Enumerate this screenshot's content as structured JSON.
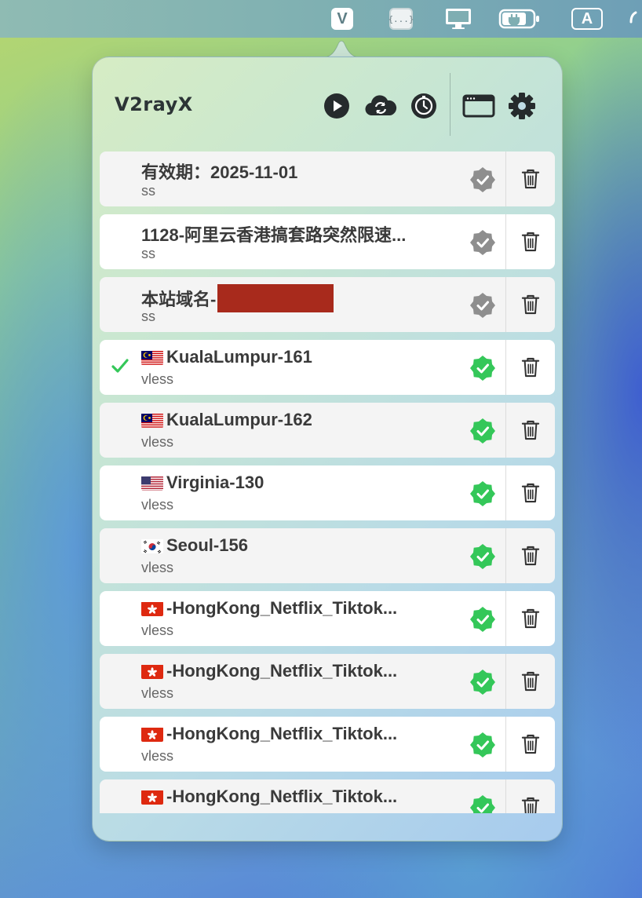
{
  "menubar": {
    "items": [
      {
        "name": "v2rayx-menubar-icon",
        "label": "V"
      },
      {
        "name": "json-menubar-icon",
        "label": "{...}"
      },
      {
        "name": "display-icon",
        "label": ""
      },
      {
        "name": "battery-icon",
        "label": ""
      },
      {
        "name": "input-source-icon",
        "label": "A"
      }
    ]
  },
  "app": {
    "title": "V2rayX"
  },
  "toolbar": {
    "icons": [
      "play-icon",
      "cloud-sync-icon",
      "timer-icon",
      "window-icon",
      "gear-icon"
    ]
  },
  "servers": [
    {
      "title": "有效期：2025-11-01",
      "protocol": "ss",
      "flag": "",
      "selected": false,
      "verified_color": "#8e8e8e",
      "redacted": false
    },
    {
      "title": "1128-阿里云香港搞套路突然限速...",
      "protocol": "ss",
      "flag": "",
      "selected": false,
      "verified_color": "#8e8e8e",
      "redacted": false
    },
    {
      "title": "本站域名-",
      "protocol": "ss",
      "flag": "",
      "selected": false,
      "verified_color": "#8e8e8e",
      "redacted": true
    },
    {
      "title": "KualaLumpur-161",
      "protocol": "vless",
      "flag": "my",
      "selected": true,
      "verified_color": "#34c759",
      "redacted": false
    },
    {
      "title": "KualaLumpur-162",
      "protocol": "vless",
      "flag": "my",
      "selected": false,
      "verified_color": "#34c759",
      "redacted": false
    },
    {
      "title": "Virginia-130",
      "protocol": "vless",
      "flag": "us",
      "selected": false,
      "verified_color": "#34c759",
      "redacted": false
    },
    {
      "title": "Seoul-156",
      "protocol": "vless",
      "flag": "kr",
      "selected": false,
      "verified_color": "#34c759",
      "redacted": false
    },
    {
      "title": "-HongKong_Netflix_Tiktok...",
      "protocol": "vless",
      "flag": "hk",
      "selected": false,
      "verified_color": "#34c759",
      "redacted": false
    },
    {
      "title": "-HongKong_Netflix_Tiktok...",
      "protocol": "vless",
      "flag": "hk",
      "selected": false,
      "verified_color": "#34c759",
      "redacted": false
    },
    {
      "title": "-HongKong_Netflix_Tiktok...",
      "protocol": "vless",
      "flag": "hk",
      "selected": false,
      "verified_color": "#34c759",
      "redacted": false
    },
    {
      "title": "-HongKong_Netflix_Tiktok...",
      "protocol": "",
      "flag": "hk",
      "selected": false,
      "verified_color": "#34c759",
      "redacted": false
    }
  ],
  "colors": {
    "selected_check": "#34c759",
    "verified": "#34c759",
    "unverified": "#8e8e8e",
    "redaction": "#a82a1c"
  }
}
